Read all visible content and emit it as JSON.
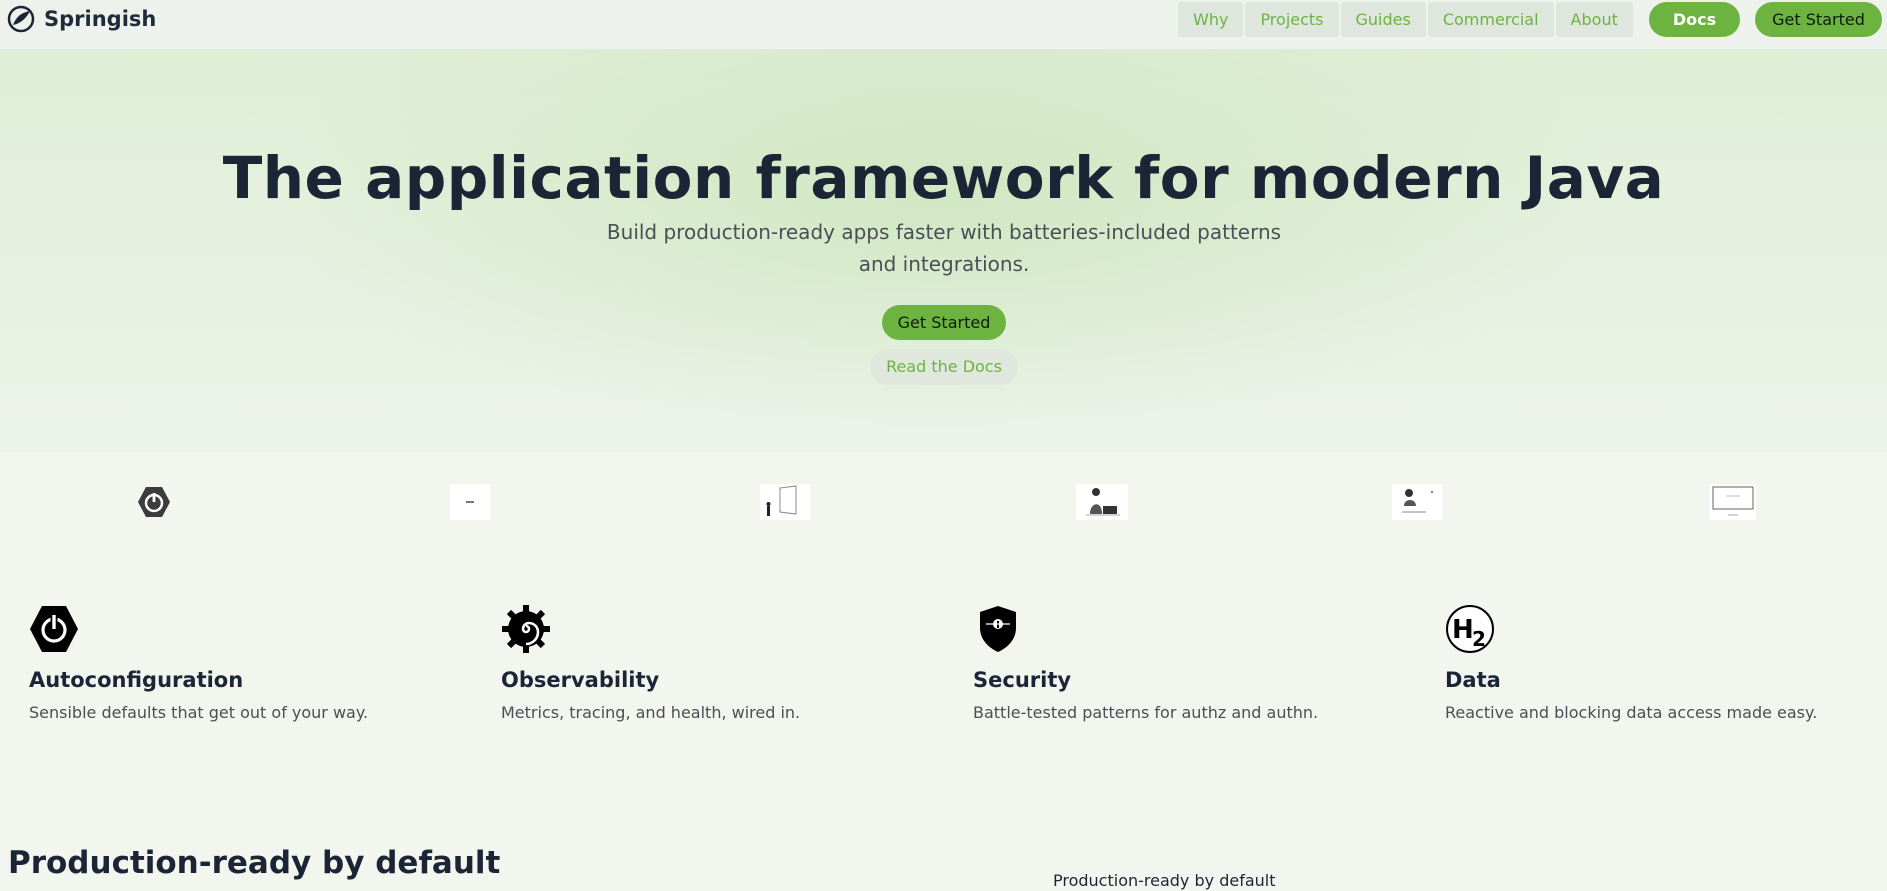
{
  "brand": {
    "name": "Springish",
    "logo_icon": "leaf-swirl-icon"
  },
  "nav": {
    "items": [
      "Why",
      "Projects",
      "Guides",
      "Commercial",
      "About"
    ]
  },
  "header_buttons": {
    "docs": "Docs",
    "get_started": "Get Started"
  },
  "hero": {
    "title": "The application framework for modern Java",
    "subtitle": "Build production-ready apps faster with batteries-included patterns and integrations.",
    "primary_button": "Get Started",
    "secondary_button": "Read the Docs"
  },
  "logo_strip": {
    "items": [
      "power-icon",
      "tiny-logo-image",
      "door-illustration",
      "person-laptop-illustration",
      "person-desk-illustration",
      "monitor-illustration"
    ]
  },
  "features": [
    {
      "icon": "power-hexagon-icon",
      "title": "Autoconfiguration",
      "description": "Sensible defaults that get out of your way."
    },
    {
      "icon": "spiral-gear-icon",
      "title": "Observability",
      "description": "Metrics, tracing, and health, wired in."
    },
    {
      "icon": "shield-icon",
      "title": "Security",
      "description": "Battle-tested patterns for authz and authn."
    },
    {
      "icon": "h2-database-icon",
      "title": "Data",
      "description": "Reactive and blocking data access made easy."
    }
  ],
  "section": {
    "title": "Production-ready by default",
    "caption": "Production-ready by default"
  },
  "colors": {
    "accent": "#6db33f",
    "text_dark": "#1b2535",
    "text_muted": "#4a4f55",
    "page_bg": "#f3f6ef"
  }
}
